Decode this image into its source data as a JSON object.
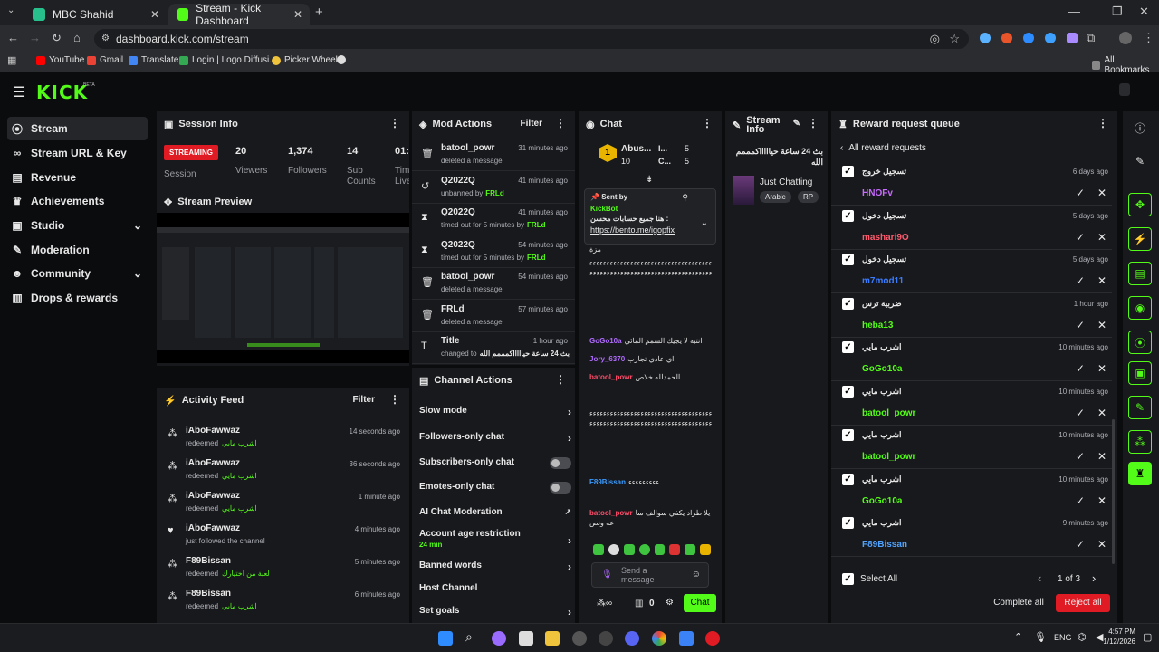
{
  "browser": {
    "tabs": [
      {
        "label": "MBC Shahid"
      },
      {
        "label": "Stream - Kick Dashboard"
      }
    ],
    "url": "dashboard.kick.com/stream",
    "bookmarks": [
      "YouTube",
      "Gmail",
      "Translate",
      "Login | Logo Diffusi...",
      "Picker Wheel"
    ],
    "all_bookmarks": "All Bookmarks"
  },
  "sidebar": {
    "logo": "KICK",
    "beta": "BETA",
    "items": [
      {
        "label": "Stream"
      },
      {
        "label": "Stream URL & Key"
      },
      {
        "label": "Revenue"
      },
      {
        "label": "Achievements"
      },
      {
        "label": "Studio"
      },
      {
        "label": "Moderation"
      },
      {
        "label": "Community"
      },
      {
        "label": "Drops & rewards"
      }
    ]
  },
  "session": {
    "title": "Session Info",
    "badge": "STREAMING",
    "badge_label": "Session",
    "stats": [
      {
        "value": "20",
        "label": "Viewers"
      },
      {
        "value": "1,374",
        "label": "Followers"
      },
      {
        "value": "14",
        "label": "Sub Counts"
      },
      {
        "value": "01:",
        "label": "Tim Live"
      }
    ]
  },
  "preview": {
    "title": "Stream Preview"
  },
  "activity": {
    "title": "Activity Feed",
    "filter": "Filter",
    "items": [
      {
        "user": "iAboFawwaz",
        "action": "redeemed",
        "reward": "اشرب مايي",
        "time": "14 seconds ago"
      },
      {
        "user": "iAboFawwaz",
        "action": "redeemed",
        "reward": "اشرب مايي",
        "time": "36 seconds ago"
      },
      {
        "user": "iAboFawwaz",
        "action": "redeemed",
        "reward": "اشرب مايي",
        "time": "1 minute ago"
      },
      {
        "user": "iAboFawwaz",
        "action": "just followed the channel",
        "reward": "",
        "time": "4 minutes ago"
      },
      {
        "user": "F89Bissan",
        "action": "redeemed",
        "reward": "لعبة من اختيارك",
        "time": "5 minutes ago"
      },
      {
        "user": "F89Bissan",
        "action": "redeemed",
        "reward": "اشرب مايي",
        "time": "6 minutes ago"
      }
    ]
  },
  "mod": {
    "title": "Mod Actions",
    "filter": "Filter",
    "items": [
      {
        "name": "batool_powr",
        "sub": "deleted a message",
        "by": "",
        "time": "31 minutes ago"
      },
      {
        "name": "Q2022Q",
        "sub": "unbanned by",
        "by": "FRLd",
        "time": "41 minutes ago"
      },
      {
        "name": "Q2022Q",
        "sub": "timed out for 5 minutes by",
        "by": "FRLd",
        "time": "41 minutes ago"
      },
      {
        "name": "Q2022Q",
        "sub": "timed out for 5 minutes by",
        "by": "FRLd",
        "time": "54 minutes ago"
      },
      {
        "name": "batool_powr",
        "sub": "deleted a message",
        "by": "",
        "time": "54 minutes ago"
      },
      {
        "name": "FRLd",
        "sub": "deleted a message",
        "by": "",
        "time": "57 minutes ago"
      },
      {
        "name": "Title",
        "sub": "changed to",
        "by": "بث 24 ساعة حياااااكمممم الله",
        "time": "1 hour ago"
      }
    ]
  },
  "channel": {
    "title": "Channel Actions",
    "items": [
      {
        "label": "Slow mode"
      },
      {
        "label": "Followers-only chat"
      },
      {
        "label": "Subscribers-only chat"
      },
      {
        "label": "Emotes-only chat"
      },
      {
        "label": "AI Chat Moderation"
      },
      {
        "label": "Account age restriction",
        "sub": "24 min"
      },
      {
        "label": "Banned words"
      },
      {
        "label": "Host Channel"
      },
      {
        "label": "Set goals"
      }
    ]
  },
  "chat": {
    "title": "Chat",
    "top": {
      "rank": "1",
      "name": "Abus...",
      "count": "10",
      "n1": "I...",
      "v1": "5",
      "n2": "C...",
      "v2": "5"
    },
    "pinned": {
      "sent_by": "Sent by",
      "user": "KickBot",
      "text": "هنا جميع حسابات محسن :",
      "link": "https://bento.me/igopfix"
    },
    "msgs": [
      {
        "user": "",
        "text": "مزة"
      },
      {
        "user": "",
        "text": "ءءءءءءءءءءءءءءءءءءءءءءءءءءءءءءءءءءءءءءءءءءءءءءءءءءءءءءءءءءءءءءءءءءءءءءءء"
      },
      {
        "user": "GoGo10a",
        "text": "انتبه لا يجيك السمم المائي"
      },
      {
        "user": "Jory_6370",
        "text": "اي عادي تجارب"
      },
      {
        "user": "batool_powr",
        "text": "الحمدلله خلاص"
      },
      {
        "user": "",
        "text": "ءءءءءءءءءءءءءءءءءءءءءءءءءءءءءءءءءءءءءءءءءءءءءءءءءءءءءءءءءءءءءءءءءءءءءءءء"
      },
      {
        "user": "F89Bissan",
        "text": "ءءءءءءءءء"
      },
      {
        "user": "batool_powr",
        "text": "يلا طراد يكفي سوالف ساعه ونص"
      }
    ],
    "input_placeholder": "Send a message",
    "footer_count": "0",
    "send": "Chat"
  },
  "info": {
    "title": "Stream Info",
    "stream_title": "بث 24 ساعة حياااااكمممم الله",
    "category": "Just Chatting",
    "tags": [
      "Arabic",
      "RP"
    ]
  },
  "rewards": {
    "title": "Reward request queue",
    "back": "All reward requests",
    "items": [
      {
        "title": "تسجيل خروج",
        "user": "HNOFv",
        "time": "6 days ago",
        "color": "#c86bff"
      },
      {
        "title": "تسجيل دخول",
        "user": "mashari9O",
        "time": "5 days ago",
        "color": "#ff5b6e"
      },
      {
        "title": "تسجيل دخول",
        "user": "m7mod11",
        "time": "5 days ago",
        "color": "#3b7cff"
      },
      {
        "title": "ضربية ترس",
        "user": "heba13",
        "time": "1 hour ago",
        "color": "#53fc18"
      },
      {
        "title": "اشرب مايي",
        "user": "GoGo10a",
        "time": "10 minutes ago",
        "color": "#53fc18"
      },
      {
        "title": "اشرب مايي",
        "user": "batool_powr",
        "time": "10 minutes ago",
        "color": "#53fc18"
      },
      {
        "title": "اشرب مايي",
        "user": "batool_powr",
        "time": "10 minutes ago",
        "color": "#53fc18"
      },
      {
        "title": "اشرب مايي",
        "user": "GoGo10a",
        "time": "10 minutes ago",
        "color": "#53fc18"
      },
      {
        "title": "اشرب مايي",
        "user": "F89Bissan",
        "time": "9 minutes ago",
        "color": "#4fa3ff"
      }
    ],
    "select_all": "Select All",
    "pager": "1 of 3",
    "complete": "Complete all",
    "reject": "Reject all"
  },
  "taskbar": {
    "lang": "ENG",
    "time": "4:57 PM",
    "date": "1/12/2026"
  },
  "colors": {
    "accent": "#53fc18",
    "danger": "#e11b23"
  }
}
